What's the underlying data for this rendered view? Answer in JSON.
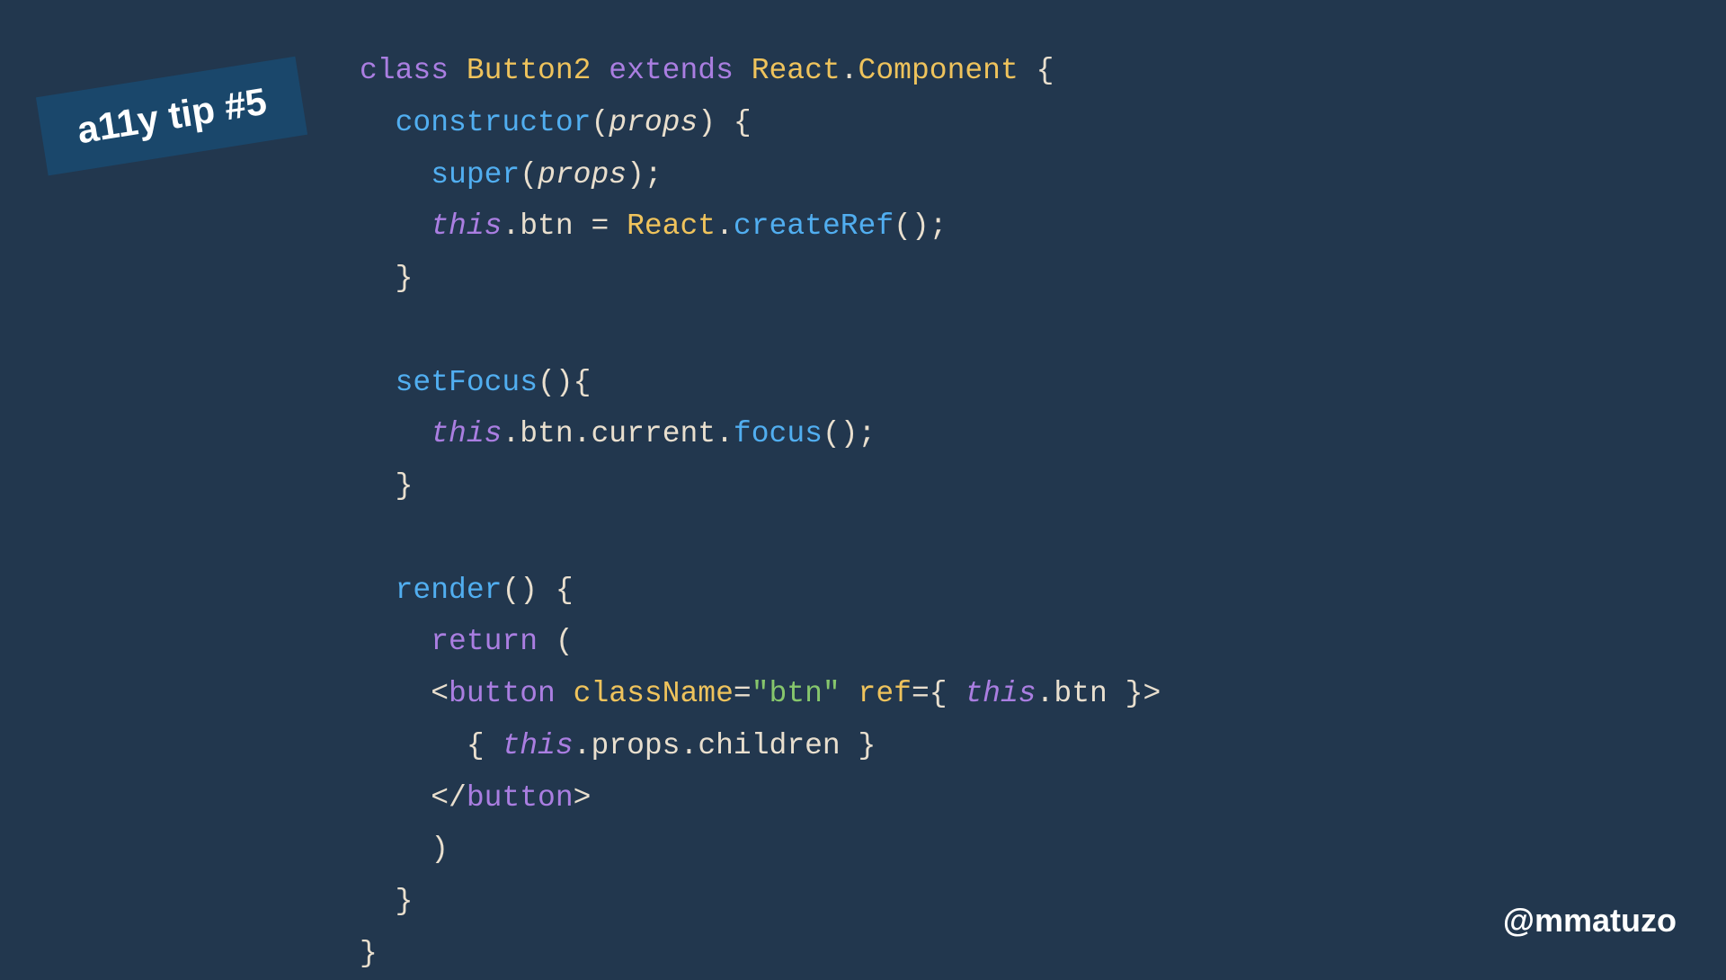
{
  "badge": {
    "text": "a11y tip #5"
  },
  "handle": {
    "text": "@mmatuzo"
  },
  "code": {
    "tokens": [
      [
        {
          "t": "class ",
          "c": "tok-keyword"
        },
        {
          "t": "Button2 ",
          "c": "tok-class"
        },
        {
          "t": "extends ",
          "c": "tok-keyword"
        },
        {
          "t": "React",
          "c": "tok-class"
        },
        {
          "t": ".",
          "c": "tok-punct"
        },
        {
          "t": "Component ",
          "c": "tok-class"
        },
        {
          "t": "{",
          "c": "tok-punct"
        }
      ],
      [
        {
          "t": "  ",
          "c": ""
        },
        {
          "t": "constructor",
          "c": "tok-method"
        },
        {
          "t": "(",
          "c": "tok-punct"
        },
        {
          "t": "props",
          "c": "tok-param"
        },
        {
          "t": ") {",
          "c": "tok-punct"
        }
      ],
      [
        {
          "t": "    ",
          "c": ""
        },
        {
          "t": "super",
          "c": "tok-method"
        },
        {
          "t": "(",
          "c": "tok-punct"
        },
        {
          "t": "props",
          "c": "tok-param"
        },
        {
          "t": ");",
          "c": "tok-punct"
        }
      ],
      [
        {
          "t": "    ",
          "c": ""
        },
        {
          "t": "this",
          "c": "tok-this"
        },
        {
          "t": ".",
          "c": "tok-punct"
        },
        {
          "t": "btn ",
          "c": "tok-prop"
        },
        {
          "t": "= ",
          "c": "tok-punct"
        },
        {
          "t": "React",
          "c": "tok-class"
        },
        {
          "t": ".",
          "c": "tok-punct"
        },
        {
          "t": "createRef",
          "c": "tok-call"
        },
        {
          "t": "();",
          "c": "tok-punct"
        }
      ],
      [
        {
          "t": "  }",
          "c": "tok-punct"
        }
      ],
      [
        {
          "t": " ",
          "c": ""
        }
      ],
      [
        {
          "t": "  ",
          "c": ""
        },
        {
          "t": "setFocus",
          "c": "tok-method"
        },
        {
          "t": "(){",
          "c": "tok-punct"
        }
      ],
      [
        {
          "t": "    ",
          "c": ""
        },
        {
          "t": "this",
          "c": "tok-this"
        },
        {
          "t": ".",
          "c": "tok-punct"
        },
        {
          "t": "btn",
          "c": "tok-prop"
        },
        {
          "t": ".",
          "c": "tok-punct"
        },
        {
          "t": "current",
          "c": "tok-prop"
        },
        {
          "t": ".",
          "c": "tok-punct"
        },
        {
          "t": "focus",
          "c": "tok-call"
        },
        {
          "t": "();",
          "c": "tok-punct"
        }
      ],
      [
        {
          "t": "  }",
          "c": "tok-punct"
        }
      ],
      [
        {
          "t": " ",
          "c": ""
        }
      ],
      [
        {
          "t": "  ",
          "c": ""
        },
        {
          "t": "render",
          "c": "tok-method"
        },
        {
          "t": "() {",
          "c": "tok-punct"
        }
      ],
      [
        {
          "t": "    ",
          "c": ""
        },
        {
          "t": "return ",
          "c": "tok-keyword"
        },
        {
          "t": "(",
          "c": "tok-punct"
        }
      ],
      [
        {
          "t": "    ",
          "c": ""
        },
        {
          "t": "<",
          "c": "tok-bracket"
        },
        {
          "t": "button ",
          "c": "tok-tag"
        },
        {
          "t": "className",
          "c": "tok-attr"
        },
        {
          "t": "=",
          "c": "tok-punct"
        },
        {
          "t": "\"btn\" ",
          "c": "tok-string"
        },
        {
          "t": "ref",
          "c": "tok-attr"
        },
        {
          "t": "={ ",
          "c": "tok-punct"
        },
        {
          "t": "this",
          "c": "tok-this"
        },
        {
          "t": ".",
          "c": "tok-punct"
        },
        {
          "t": "btn ",
          "c": "tok-prop"
        },
        {
          "t": "}",
          "c": "tok-punct"
        },
        {
          "t": ">",
          "c": "tok-bracket"
        }
      ],
      [
        {
          "t": "      { ",
          "c": "tok-punct"
        },
        {
          "t": "this",
          "c": "tok-this"
        },
        {
          "t": ".",
          "c": "tok-punct"
        },
        {
          "t": "props",
          "c": "tok-prop"
        },
        {
          "t": ".",
          "c": "tok-punct"
        },
        {
          "t": "children ",
          "c": "tok-prop"
        },
        {
          "t": "}",
          "c": "tok-punct"
        }
      ],
      [
        {
          "t": "    ",
          "c": ""
        },
        {
          "t": "</",
          "c": "tok-bracket"
        },
        {
          "t": "button",
          "c": "tok-tag"
        },
        {
          "t": ">",
          "c": "tok-bracket"
        }
      ],
      [
        {
          "t": "    )",
          "c": "tok-punct"
        }
      ],
      [
        {
          "t": "  }",
          "c": "tok-punct"
        }
      ],
      [
        {
          "t": "}",
          "c": "tok-punct"
        }
      ]
    ]
  }
}
